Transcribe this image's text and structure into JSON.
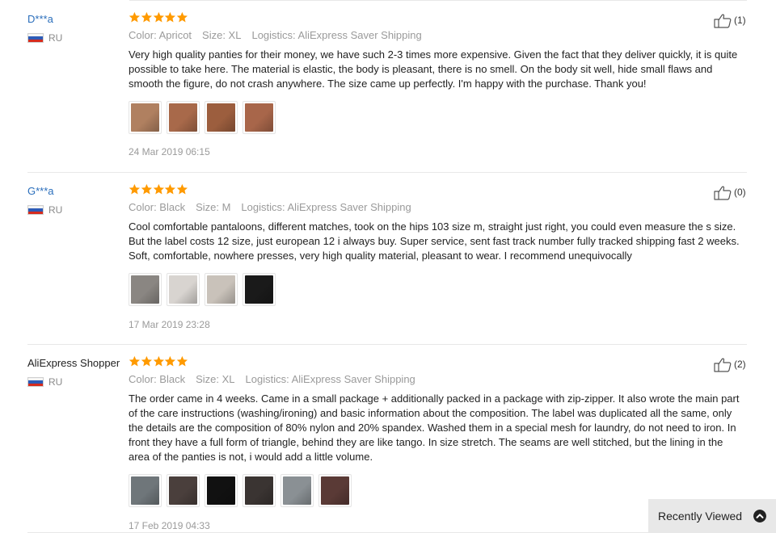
{
  "reviews": [
    {
      "name": "D***a",
      "country": "RU",
      "rating": 5,
      "likes": "(1)",
      "color": "Color: Apricot",
      "size": "Size: XL",
      "logistics": "Logistics: AliExpress Saver Shipping",
      "text": "Very high quality panties for their money, we have such 2-3 times more expensive. Given the fact that they deliver quickly, it is quite possible to take here. The material is elastic, the body is pleasant, there is no smell. On the body sit well, hide small flaws and smooth the figure, do not crash anywhere. The size came up perfectly. I'm happy with the purchase. Thank you!",
      "date": "24 Mar 2019 06:15",
      "photos": [
        "#b08060",
        "#a8694a",
        "#9c5e3e",
        "#a8664a"
      ]
    },
    {
      "name": "G***a",
      "country": "RU",
      "rating": 5,
      "likes": "(0)",
      "color": "Color: Black",
      "size": "Size: M",
      "logistics": "Logistics: AliExpress Saver Shipping",
      "text": "Cool comfortable pantaloons, different matches, took on the hips 103 size m, straight just right, you could even measure the s size. But the label costs 12 size, just european 12 i always buy. Super service, sent fast track number fully tracked shipping fast 2 weeks. Soft, comfortable, nowhere presses, very high quality material, pleasant to wear. I recommend unequivocally",
      "date": "17 Mar 2019 23:28",
      "photos": [
        "#8a8682",
        "#d8d4d0",
        "#c9c2ba",
        "#1a1a1a"
      ]
    },
    {
      "name": "AliExpress Shopper",
      "country": "RU",
      "rating": 5,
      "likes": "(2)",
      "color": "Color: Black",
      "size": "Size: XL",
      "logistics": "Logistics: AliExpress Saver Shipping",
      "text": "The order came in 4 weeks. Came in a small package + additionally packed in a package with zip-zipper. It also wrote the main part of the care instructions (washing/ironing) and basic information about the composition. The label was duplicated all the same, only the details are the composition of 80% nylon and 20% spandex. Washed them in a special mesh for laundry, do not need to iron. In front they have a full form of triangle, behind they are like tango. In size stretch. The seams are well stitched, but the lining in the area of the panties is not, i would add a little volume.",
      "date": "17 Feb 2019 04:33",
      "photos": [
        "#6f767a",
        "#4a3f3c",
        "#111111",
        "#3a3432",
        "#8a9094",
        "#5a3a36"
      ]
    }
  ],
  "recently_viewed": {
    "label": "Recently Viewed"
  },
  "colors": {
    "star": "#ff9a00",
    "link": "#2a6ebb"
  }
}
